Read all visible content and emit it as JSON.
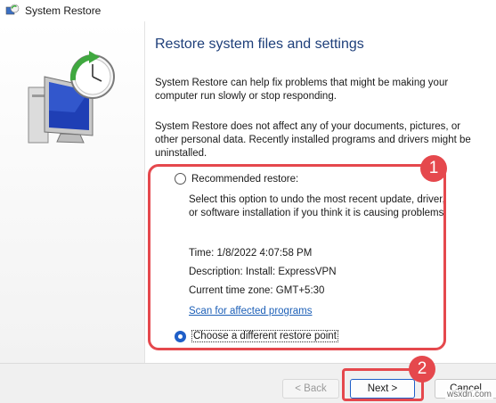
{
  "window": {
    "title": "System Restore"
  },
  "main": {
    "heading": "Restore system files and settings",
    "para1": "System Restore can help fix problems that might be making your computer run slowly or stop responding.",
    "para2": "System Restore does not affect any of your documents, pictures, or other personal data. Recently installed programs and drivers might be uninstalled."
  },
  "options": {
    "recommended": {
      "label": "Recommended restore:",
      "checked": false,
      "description": "Select this option to undo the most recent update, driver, or software installation if you think it is causing problems.",
      "time": "Time: 1/8/2022 4:07:58 PM",
      "restore_description": "Description: Install: ExpressVPN",
      "timezone": "Current time zone: GMT+5:30",
      "scan_link": "Scan for affected programs"
    },
    "different": {
      "label": "Choose a different restore point",
      "checked": true
    }
  },
  "annotations": {
    "badge1": "1",
    "badge2": "2",
    "color": "#e5484d"
  },
  "footer": {
    "back_label": "< Back",
    "next_label": "Next >",
    "cancel_label": "Cancel"
  },
  "watermark": "wsxdn.com"
}
